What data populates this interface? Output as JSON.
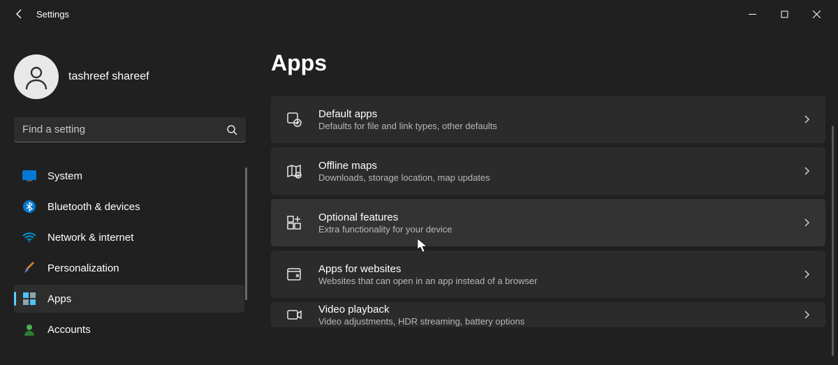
{
  "window": {
    "title": "Settings"
  },
  "profile": {
    "name": "tashreef shareef"
  },
  "search": {
    "placeholder": "Find a setting"
  },
  "sidebar": {
    "items": [
      {
        "label": "System"
      },
      {
        "label": "Bluetooth & devices"
      },
      {
        "label": "Network & internet"
      },
      {
        "label": "Personalization"
      },
      {
        "label": "Apps"
      },
      {
        "label": "Accounts"
      }
    ]
  },
  "main": {
    "heading": "Apps",
    "cards": [
      {
        "title": "Default apps",
        "subtitle": "Defaults for file and link types, other defaults"
      },
      {
        "title": "Offline maps",
        "subtitle": "Downloads, storage location, map updates"
      },
      {
        "title": "Optional features",
        "subtitle": "Extra functionality for your device"
      },
      {
        "title": "Apps for websites",
        "subtitle": "Websites that can open in an app instead of a browser"
      },
      {
        "title": "Video playback",
        "subtitle": "Video adjustments, HDR streaming, battery options"
      }
    ]
  }
}
